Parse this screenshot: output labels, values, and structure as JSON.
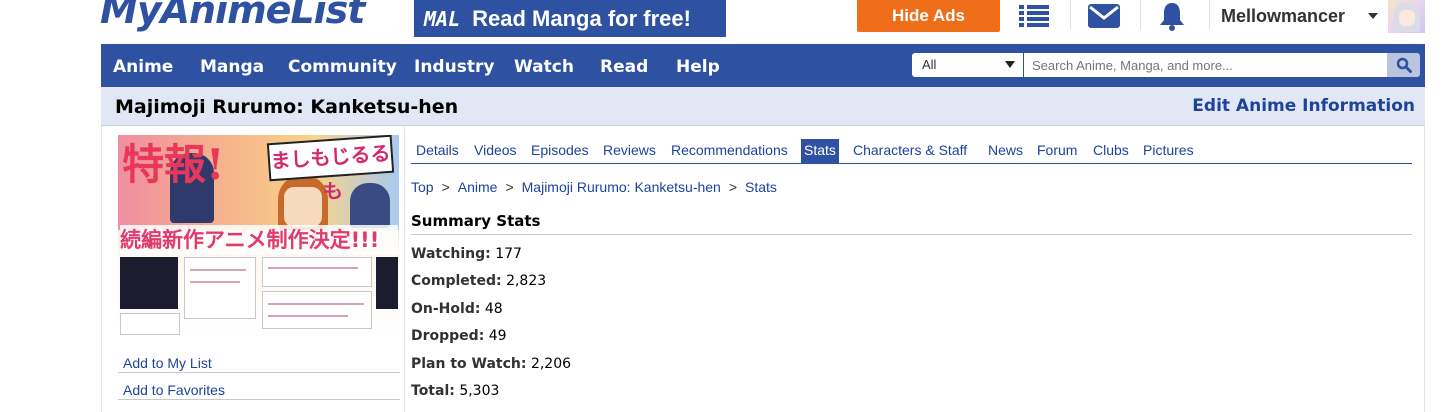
{
  "header": {
    "logo_text": "MyAnimeList",
    "banner_tag": "MAL",
    "banner_text": "Read Manga for free!",
    "hide_ads": "Hide Ads",
    "username": "Mellowmancer",
    "icons": [
      "list-icon",
      "mail-icon",
      "bell-icon"
    ]
  },
  "nav": {
    "items": [
      "Anime",
      "Manga",
      "Community",
      "Industry",
      "Watch",
      "Read",
      "Help"
    ],
    "search_filter": "All",
    "search_placeholder": "Search Anime, Manga, and more..."
  },
  "page": {
    "title": "Majimoji Rurumo: Kanketsu-hen",
    "edit_link": "Edit Anime Information"
  },
  "sidebar": {
    "cover_headline": "続編新作アニメ制作決定!!!",
    "cover_kanji": "特報!",
    "cover_logo": "ましもじるるも",
    "links": [
      "Add to My List",
      "Add to Favorites"
    ]
  },
  "tabs": {
    "items": [
      "Details",
      "Videos",
      "Episodes",
      "Reviews",
      "Recommendations",
      "Stats",
      "Characters & Staff",
      "News",
      "Forum",
      "Clubs",
      "Pictures"
    ],
    "active": "Stats"
  },
  "breadcrumb": [
    "Top",
    "Anime",
    "Majimoji Rurumo: Kanketsu-hen",
    "Stats"
  ],
  "summary": {
    "heading": "Summary Stats",
    "stats": [
      {
        "label": "Watching:",
        "value": "177"
      },
      {
        "label": "Completed:",
        "value": "2,823"
      },
      {
        "label": "On-Hold:",
        "value": "48"
      },
      {
        "label": "Dropped:",
        "value": "49"
      },
      {
        "label": "Plan to Watch:",
        "value": "2,206"
      },
      {
        "label": "Total:",
        "value": "5,303"
      }
    ]
  },
  "colors": {
    "brand_blue": "#2e51a2",
    "hide_ads_orange": "#ef6e1a",
    "title_bar_bg": "#e1e7f5",
    "link_blue": "#1d439b"
  }
}
